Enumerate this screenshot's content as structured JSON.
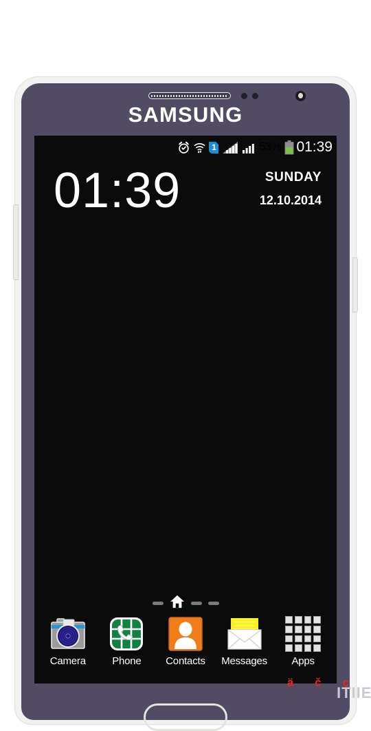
{
  "device": {
    "brand": "SAMSUNG",
    "hardware": {
      "earpiece": "earpiece-speaker",
      "front_camera": "front-camera",
      "volume_button": "volume-rocker",
      "power_button": "power-button",
      "home_button": "home-button"
    },
    "colors": {
      "bezel": "#514c63",
      "frame": "#f2f2f0",
      "screen": "#0b0b0b"
    }
  },
  "status_bar": {
    "alarm_icon": "alarm-clock-icon",
    "wifi_icon": "wifi-icon",
    "sim_badge": "1",
    "signal_icon_1": "signal-bars-icon",
    "signal_icon_2": "signal-bars-icon",
    "battery_percent": "53%",
    "battery_icon": "battery-icon",
    "battery_level": 53,
    "battery_color": "#7ac143",
    "clock": "01:39"
  },
  "clock_widget": {
    "time": "01:39",
    "day": "SUNDAY",
    "date": "12.10.2014"
  },
  "home_screen": {
    "page_indicator": {
      "home_icon": "home-icon",
      "pages": 4,
      "active_index": 1
    },
    "dock": [
      {
        "label": "Camera",
        "icon": "camera-icon"
      },
      {
        "label": "Phone",
        "icon": "phone-icon"
      },
      {
        "label": "Contacts",
        "icon": "contacts-icon"
      },
      {
        "label": "Messages",
        "icon": "messages-icon"
      },
      {
        "label": "Apps",
        "icon": "apps-grid-icon"
      }
    ]
  },
  "watermark": {
    "chars": "ä č ç",
    "logo": "ITIIE"
  }
}
